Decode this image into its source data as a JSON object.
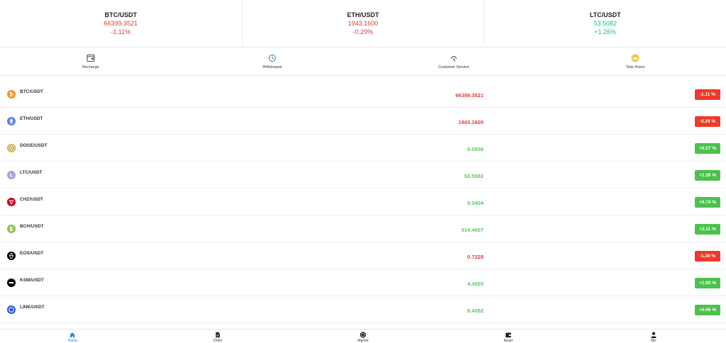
{
  "tickers": [
    {
      "pair": "BTC/USDT",
      "price": "66399.3521",
      "change": "-1.11%",
      "trend": "down"
    },
    {
      "pair": "ETH/USDT",
      "price": "1943.1600",
      "change": "-0.29%",
      "trend": "down"
    },
    {
      "pair": "LTC/USDT",
      "price": "53.5082",
      "change": "+1.26%",
      "trend": "up"
    }
  ],
  "actions": [
    {
      "label": "Recharge",
      "icon": "wallet-icon"
    },
    {
      "label": "Withdrawal",
      "icon": "withdraw-clock-icon"
    },
    {
      "label": "Customer Service",
      "icon": "headset-icon"
    },
    {
      "label": "Task Rules",
      "icon": "crown-icon"
    }
  ],
  "markets": [
    {
      "pair": "BTC/USDT",
      "price": "66399.3521",
      "change": "-1.11 %",
      "trend": "down",
      "icon": "btc-icon",
      "color": "#f7931a"
    },
    {
      "pair": "ETH/USDT",
      "price": "1943.1600",
      "change": "-0.29 %",
      "trend": "down",
      "icon": "eth-icon",
      "color": "#627eea"
    },
    {
      "pair": "DOGE/USDT",
      "price": "0.0936",
      "change": "+0.27 %",
      "trend": "up",
      "icon": "doge-icon",
      "color": "#c2a633"
    },
    {
      "pair": "LTC/USDT",
      "price": "53.5082",
      "change": "+1.26 %",
      "trend": "up",
      "icon": "ltc-icon",
      "color": "#a0a7d6"
    },
    {
      "pair": "CHZ/USDT",
      "price": "0.0404",
      "change": "+0.74 %",
      "trend": "up",
      "icon": "chz-icon",
      "color": "#cd0124"
    },
    {
      "pair": "BCH/USDT",
      "price": "514.4007",
      "change": "+2.11 %",
      "trend": "up",
      "icon": "bch-icon",
      "color": "#8dc351"
    },
    {
      "pair": "EOS/USDT",
      "price": "0.7228",
      "change": "-1.39 %",
      "trend": "down",
      "icon": "eos-icon",
      "color": "#000000"
    },
    {
      "pair": "KSM/USDT",
      "price": "4.4020",
      "change": "+1.93 %",
      "trend": "up",
      "icon": "ksm-icon",
      "color": "#000000"
    },
    {
      "pair": "LINK/USDT",
      "price": "8.4052",
      "change": "+0.56 %",
      "trend": "up",
      "icon": "link-icon",
      "color": "#2a5ada"
    }
  ],
  "nav": [
    {
      "label": "Home",
      "icon": "home-icon",
      "active": true
    },
    {
      "label": "Order",
      "icon": "order-icon",
      "active": false
    },
    {
      "label": "Market",
      "icon": "market-icon",
      "active": false
    },
    {
      "label": "Asset",
      "icon": "asset-wallet-icon",
      "active": false
    },
    {
      "label": "Me",
      "icon": "user-icon",
      "active": false
    }
  ],
  "colors": {
    "down": "#ee3a2a",
    "up": "#4cc14c",
    "accent": "#1e88e5"
  }
}
